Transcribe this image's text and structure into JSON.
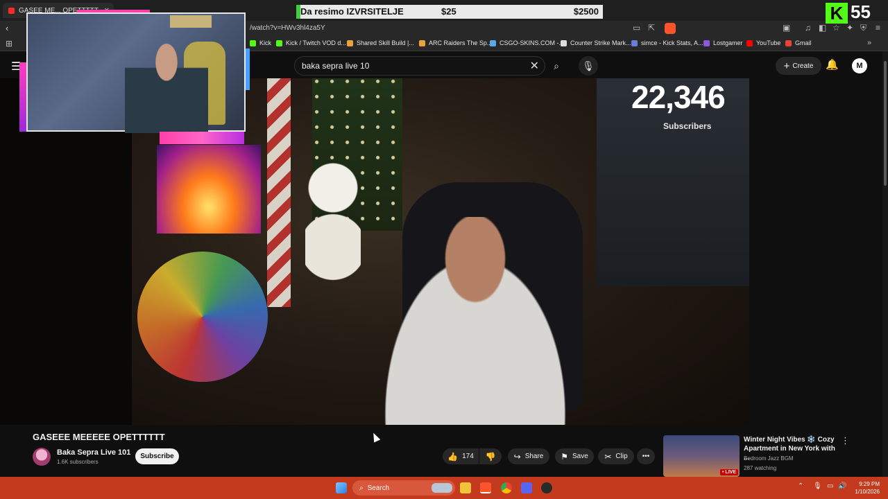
{
  "browser": {
    "tab_title": "GASEE ME... OPETTTTT",
    "url": "/watch?v=HWv3hl4za5Y",
    "bookmarks": [
      {
        "label": "Kick",
        "color": "#53fc18"
      },
      {
        "label": "Kick / Twitch VOD d...",
        "color": "#53fc18"
      },
      {
        "label": "Shared Skill Build |...",
        "color": "#e8a33a"
      },
      {
        "label": "ARC Raiders The Sp...",
        "color": "#e8a33a"
      },
      {
        "label": "CSGO-SKINS.COM -...",
        "color": "#5aa9e6"
      },
      {
        "label": "Counter Strike Mark...",
        "color": "#dddddd"
      },
      {
        "label": "simce - Kick Stats, A...",
        "color": "#6a7bd8"
      },
      {
        "label": "Lostgamer",
        "color": "#8a5ad8"
      },
      {
        "label": "YouTube",
        "color": "#ff0000"
      },
      {
        "label": "Gmail",
        "color": "#ea4335"
      }
    ]
  },
  "stream_overlay": {
    "goal_label": "Da resimo IZVRSITELJE",
    "goal_current": "$25",
    "goal_target": "$2500",
    "goal_progress": 0.01,
    "kick_letter": "K",
    "viewer_count": "55"
  },
  "youtube": {
    "search_query": "baka sepra live 10",
    "create_label": "Create",
    "avatar_letter": "M"
  },
  "video": {
    "subscriber_overlay_count": "22,346",
    "subscriber_overlay_label": "Subscribers",
    "title": "GASEEE MEEEEE OPETTTTTT",
    "channel_name": "Baka Sepra Live 101",
    "channel_subs": "1.6K subscribers",
    "subscribe_label": "Subscribe",
    "likes": "174",
    "share_label": "Share",
    "save_label": "Save",
    "clip_label": "Clip",
    "more_label": "•••"
  },
  "recommendation": {
    "title": "Winter Night Vibes ❄️ Cozy Apartment in New York with ...",
    "channel": "Bedroom Jazz BGM",
    "watching": "287 watching",
    "live_badge": "• LIVE"
  },
  "taskbar": {
    "search_label": "Search",
    "time": "9:29 PM",
    "date": "1/10/2026"
  }
}
